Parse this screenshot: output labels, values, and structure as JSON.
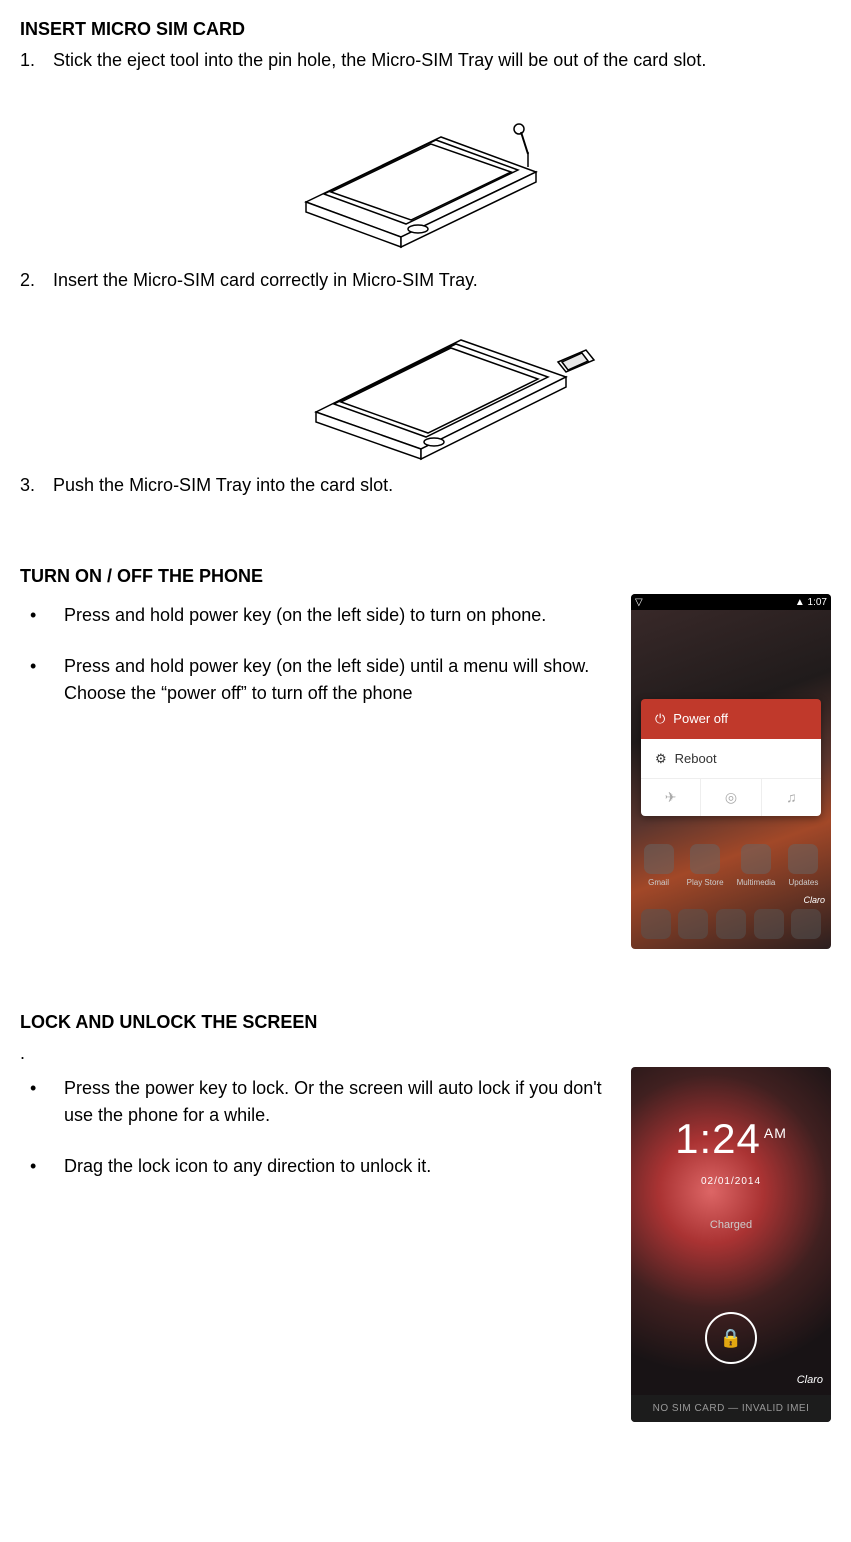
{
  "section_sim": {
    "heading": "INSERT MICRO SIM CARD",
    "steps": [
      {
        "n": "1.",
        "text": "Stick the eject tool into the pin hole, the Micro-SIM Tray will be out of the card slot."
      },
      {
        "n": "2.",
        "text": "Insert the Micro-SIM card correctly in Micro-SIM Tray."
      },
      {
        "n": "3.",
        "text": "Push the Micro-SIM Tray into the card slot."
      }
    ]
  },
  "section_power": {
    "heading": "TURN ON / OFF THE PHONE",
    "bullets": [
      "Press and hold power key (on the left side) to turn on phone.",
      "Press and hold power key (on the left side) until a menu will show. Choose the “power off” to turn off the phone"
    ]
  },
  "section_lock": {
    "heading": "LOCK AND UNLOCK THE SCREEN",
    "leader": ".",
    "bullets": [
      "Press the power key to lock. Or the screen will auto lock if you don't use the phone for a while.",
      "Drag the lock icon to any direction to unlock it."
    ]
  },
  "poweroff_ui": {
    "status_time": "1:07",
    "power_off_label": "Power off",
    "reboot_label": "Reboot",
    "quick_icons": [
      "✈",
      "◎",
      "♫"
    ],
    "apps": [
      "Gmail",
      "Play Store",
      "Multimedia",
      "Updates"
    ],
    "carrier": "Claro"
  },
  "lock_ui": {
    "time": "1:24",
    "ampm": "AM",
    "date": "02/01/2014",
    "charged": "Charged",
    "carrier": "Claro",
    "no_sim": "NO SIM CARD — INVALID IMEI"
  },
  "icons": {
    "power_glyph": "⏻",
    "reboot_glyph": "⚙",
    "signal_glyph": "▲",
    "lock_glyph": "🔒",
    "status_left": "▽"
  }
}
